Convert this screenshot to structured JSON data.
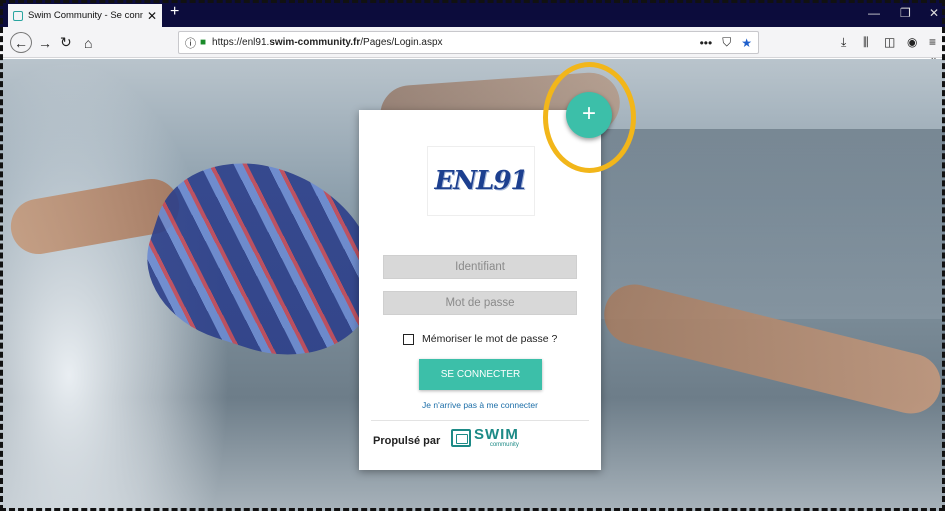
{
  "browser": {
    "tab_title": "Swim Community - Se connect",
    "tab_close": "✕",
    "new_tab": "+",
    "url_prefix": "https://enl91.",
    "url_domain": "swim-community.fr",
    "url_path": "/Pages/Login.aspx",
    "more_glyph": "•••",
    "overflow": "»"
  },
  "card": {
    "logo_text": "ENL91",
    "username_placeholder": "Identifiant",
    "password_placeholder": "Mot de passe",
    "remember_label": "Mémoriser le mot de passe ?",
    "connect_label": "SE CONNECTER",
    "help_link": "Je n'arrive pas à me connecter",
    "powered_by": "Propulsé par",
    "brand_name": "SWIM",
    "brand_sub": "community"
  },
  "fab": {
    "label": "+"
  },
  "colors": {
    "accent": "#3cbfa9",
    "highlight": "#f2b61a",
    "link": "#1c6ea8"
  },
  "icons": [
    "back-icon",
    "forward-icon",
    "reload-icon",
    "home-icon",
    "info-icon",
    "lock-icon",
    "pocket-icon",
    "bookmark-star-icon",
    "download-icon",
    "library-icon",
    "sidebar-icon",
    "account-icon",
    "menu-icon"
  ]
}
